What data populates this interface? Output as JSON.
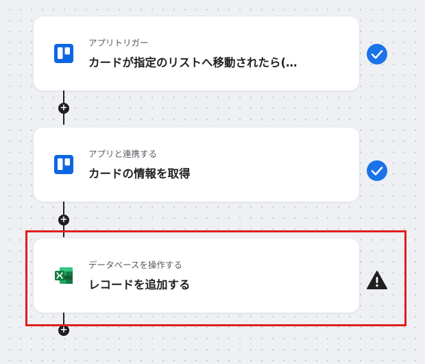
{
  "steps": [
    {
      "subtitle": "アプリトリガー",
      "title": "カードが指定のリストへ移動されたら(…",
      "app_icon": "trello-icon",
      "status": "check-icon"
    },
    {
      "subtitle": "アプリと連携する",
      "title": "カードの情報を取得",
      "app_icon": "trello-icon",
      "status": "check-icon"
    },
    {
      "subtitle": "データベースを操作する",
      "title": "レコードを追加する",
      "app_icon": "excel-icon",
      "status": "warning-icon"
    }
  ],
  "add_button_symbol": "+",
  "colors": {
    "trello": "#0c66e4",
    "excel": "#1d6f42",
    "check": "#1a73e8",
    "warning": "#1f1f1f",
    "highlight": "#e11d1d"
  }
}
